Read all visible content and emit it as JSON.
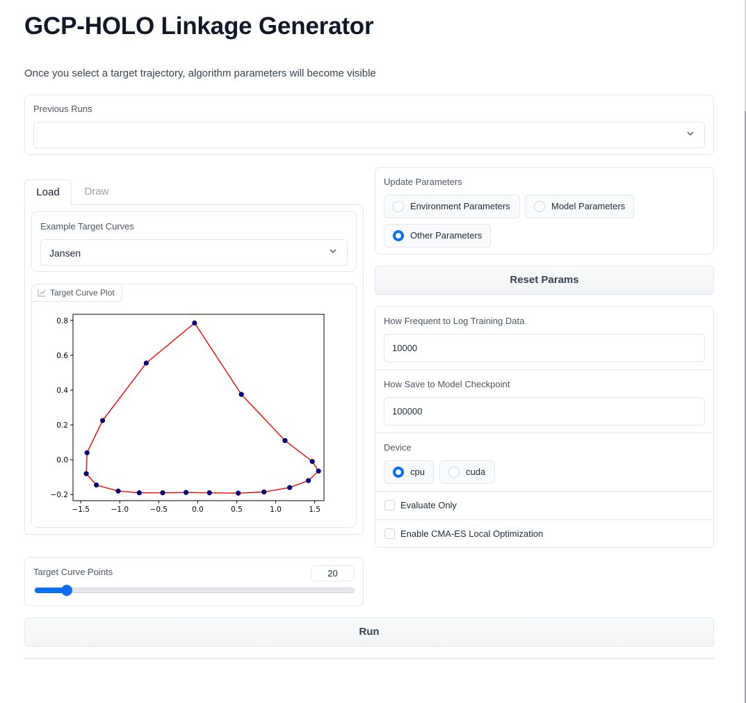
{
  "header": {
    "title": "GCP-HOLO Linkage Generator",
    "subtitle": "Once you select a target trajectory, algorithm parameters will become visible"
  },
  "previous_runs": {
    "label": "Previous Runs",
    "value": ""
  },
  "tabs": [
    {
      "label": "Load",
      "active": true
    },
    {
      "label": "Draw",
      "active": false
    }
  ],
  "example_curves": {
    "label": "Example Target Curves",
    "value": "Jansen"
  },
  "plot": {
    "label": "Target Curve Plot",
    "icon": "chart-icon"
  },
  "chart_data": {
    "type": "line",
    "title": "",
    "xlabel": "",
    "ylabel": "",
    "xlim": [
      -1.6,
      1.62
    ],
    "ylim": [
      -0.235,
      0.835
    ],
    "xticks": [
      "−1.5",
      "−1.0",
      "−0.5",
      "0.0",
      "0.5",
      "1.0",
      "1.5"
    ],
    "xtick_values": [
      -1.5,
      -1.0,
      -0.5,
      0.0,
      0.5,
      1.0,
      1.5
    ],
    "yticks": [
      "−0.2",
      "0.0",
      "0.2",
      "0.4",
      "0.6",
      "0.8"
    ],
    "ytick_values": [
      -0.2,
      0.0,
      0.2,
      0.4,
      0.6,
      0.8
    ],
    "line_color": "#ff0000",
    "marker_color": "#00008b",
    "closed": true,
    "x": [
      -0.04,
      0.56,
      1.12,
      1.47,
      1.55,
      1.42,
      1.18,
      0.85,
      0.52,
      0.15,
      -0.15,
      -0.45,
      -0.75,
      -1.02,
      -1.3,
      -1.43,
      -1.42,
      -1.22,
      -0.66
    ],
    "y": [
      0.785,
      0.375,
      0.11,
      -0.01,
      -0.065,
      -0.12,
      -0.16,
      -0.185,
      -0.192,
      -0.19,
      -0.188,
      -0.19,
      -0.19,
      -0.18,
      -0.145,
      -0.08,
      0.04,
      0.225,
      0.555
    ]
  },
  "target_points": {
    "label": "Target Curve Points",
    "value": "20",
    "fraction": 0.1
  },
  "update_params": {
    "label": "Update Parameters",
    "options": [
      "Environment Parameters",
      "Model Parameters",
      "Other Parameters"
    ],
    "selected": "Other Parameters"
  },
  "reset_button": "Reset Params",
  "log_freq": {
    "label": "How Frequent to Log Training Data",
    "value": "10000"
  },
  "checkpoint": {
    "label": "How Save to Model Checkpoint",
    "value": "100000"
  },
  "device": {
    "label": "Device",
    "options": [
      "cpu",
      "cuda"
    ],
    "selected": "cpu"
  },
  "evaluate_only": {
    "label": "Evaluate Only",
    "checked": false
  },
  "cma_es": {
    "label": "Enable CMA-ES Local Optimization",
    "checked": false
  },
  "run_button": "Run",
  "colors": {
    "accent": "#0b6ef5",
    "border": "#e5e7eb"
  }
}
